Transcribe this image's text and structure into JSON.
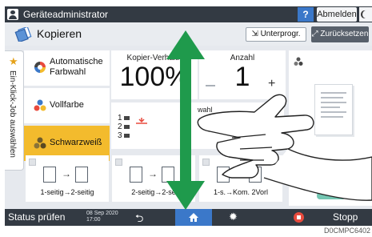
{
  "topbar": {
    "admin_label": "Geräteadministrator",
    "help_label": "?",
    "logout_label": "Abmelden"
  },
  "app": {
    "title": "Kopieren",
    "subprog_label": "Unterprogr.",
    "reset_label": "Zurücksetzen",
    "side_tab_label": "Ein-Klick-Job auswählen"
  },
  "color_modes": [
    {
      "label_line1": "Automatische",
      "label_line2": "Farbwahl",
      "selected": false
    },
    {
      "label_line1": "Vollfarbe",
      "label_line2": "",
      "selected": false
    },
    {
      "label_line1": "Schwarzweiß",
      "label_line2": "",
      "selected": true
    }
  ],
  "zoom": {
    "label": "Kopier-Verhältn",
    "value": "100%"
  },
  "count": {
    "label": "Anzahl",
    "value": "1",
    "plus": "+"
  },
  "paper": {
    "label": "wahl",
    "trays": [
      "1",
      "2",
      "3"
    ]
  },
  "duplex": [
    {
      "label": "1-seitig→2-seitig"
    },
    {
      "label": "2-seitig→2-se"
    },
    {
      "label": "1-s.→Kom. 2Vorl"
    }
  ],
  "bottombar": {
    "status_label": "Status prüfen",
    "date_line1": "08 Sep 2020",
    "date_line2": "17:00",
    "stop_label": "Stopp"
  },
  "figure_code": "D0CMPC6402",
  "colors": {
    "bar_dark": "#333a43",
    "accent_blue": "#3b78c9",
    "selected_yellow": "#f3bb2d",
    "gesture_green": "#1f9a4c",
    "stop_red": "#e84a3d"
  }
}
